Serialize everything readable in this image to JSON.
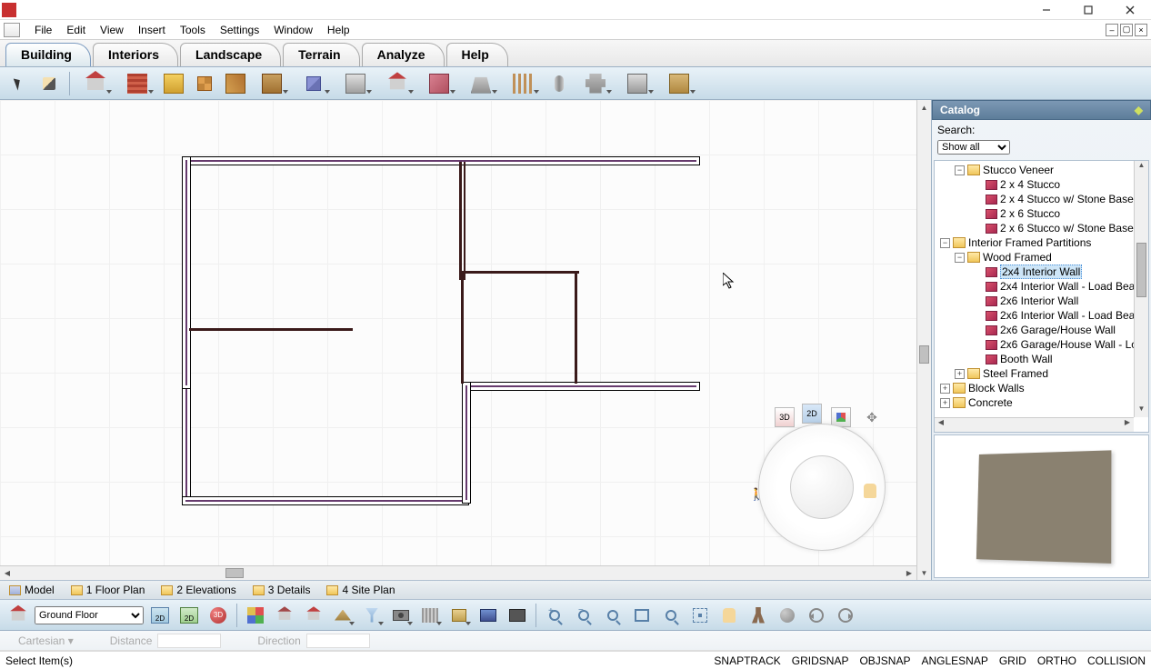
{
  "menu": {
    "items": [
      "File",
      "Edit",
      "View",
      "Insert",
      "Tools",
      "Settings",
      "Window",
      "Help"
    ]
  },
  "ribbon": {
    "tabs": [
      "Building",
      "Interiors",
      "Landscape",
      "Terrain",
      "Analyze",
      "Help"
    ],
    "active": 0
  },
  "catalog": {
    "title": "Catalog",
    "search_label": "Search:",
    "filter": "Show all",
    "tree": {
      "stucco_veneer": "Stucco Veneer",
      "stucco_items": [
        "2 x 4 Stucco",
        "2 x 4 Stucco w/ Stone Base",
        "2 x 6 Stucco",
        "2 x 6 Stucco w/ Stone Base"
      ],
      "interior_framed": "Interior Framed Partitions",
      "wood_framed": "Wood Framed",
      "wood_items": [
        "2x4 Interior Wall",
        "2x4 Interior Wall - Load Bea",
        "2x6 Interior Wall",
        "2x6 Interior Wall - Load Bea",
        "2x6 Garage/House Wall",
        "2x6 Garage/House Wall - Lo",
        "Booth Wall"
      ],
      "steel_framed": "Steel Framed",
      "block_walls": "Block Walls",
      "concrete": "Concrete",
      "selected": "2x4 Interior Wall"
    }
  },
  "viewtabs": {
    "items": [
      "Model",
      "1 Floor Plan",
      "2 Elevations",
      "3 Details",
      "4 Site Plan"
    ]
  },
  "floor_selector": "Ground Floor",
  "coord": {
    "system": "Cartesian",
    "distance_label": "Distance",
    "direction_label": "Direction"
  },
  "status": {
    "left": "Select Item(s)",
    "toggles": [
      "SNAPTRACK",
      "GRIDSNAP",
      "OBJSNAP",
      "ANGLESNAP",
      "GRID",
      "ORTHO",
      "COLLISION"
    ]
  },
  "nav": {
    "btn_3d": "3D",
    "btn_2d": "2D"
  }
}
